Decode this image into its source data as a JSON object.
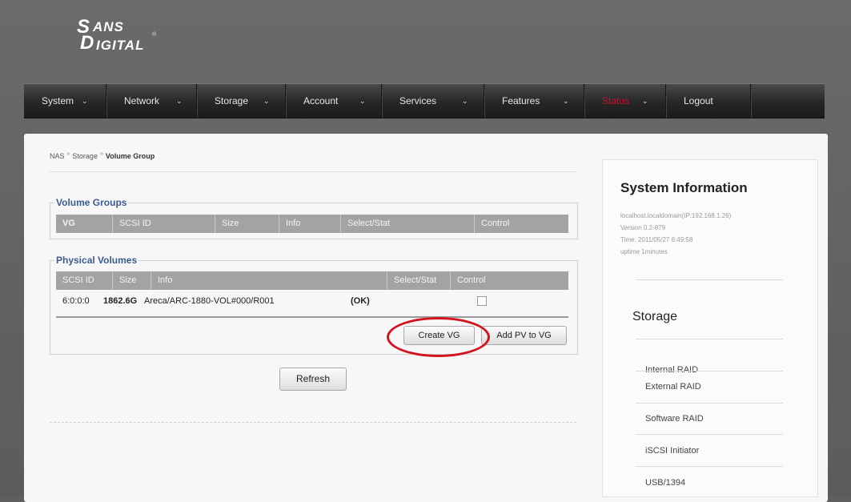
{
  "logo": {
    "line1": "ANS",
    "line2": "IGITAL",
    "letter1": "S",
    "letter2": "D",
    "trademark": "®"
  },
  "nav": {
    "items": [
      {
        "label": "System"
      },
      {
        "label": "Network"
      },
      {
        "label": "Storage"
      },
      {
        "label": "Account"
      },
      {
        "label": "Services"
      },
      {
        "label": "Features"
      },
      {
        "label": "Status"
      },
      {
        "label": "Logout"
      }
    ],
    "chevron": "⌄"
  },
  "breadcrumb": {
    "root": "NAS",
    "mid": "Storage",
    "current": "Volume Group",
    "sep": "»"
  },
  "volume_groups": {
    "legend": "Volume Groups",
    "columns": [
      "VG",
      "SCSI ID",
      "Size",
      "Info",
      "Select/Stat",
      "Control"
    ]
  },
  "physical_volumes": {
    "legend": "Physical Volumes",
    "columns": [
      "SCSI ID",
      "Size",
      "Info",
      "Select/Stat",
      "Control"
    ],
    "rows": [
      {
        "scsi_id": "6:0:0:0",
        "size": "1862.6G",
        "info": "Areca/ARC-1880-VOL#000/R001",
        "stat": "(OK)"
      }
    ],
    "create_vg": "Create VG",
    "add_pv": "Add PV to VG"
  },
  "refresh": "Refresh",
  "system_info": {
    "title": "System Information",
    "host": "localhost.localdomain(IP:192.168.1.26)",
    "version": "Version 0.2-879",
    "time": "Time: 2011/05/27 6:49:58",
    "uptime": "uptime 1minutes"
  },
  "storage_menu": {
    "title": "Storage",
    "items": [
      "Internal RAID",
      "External RAID",
      "Software RAID",
      "iSCSI Initiator",
      "USB/1394"
    ]
  },
  "colors": {
    "accent_legend": "#3b5b8e",
    "status_active": "#c8102e",
    "highlight_circle": "#d4131e"
  }
}
